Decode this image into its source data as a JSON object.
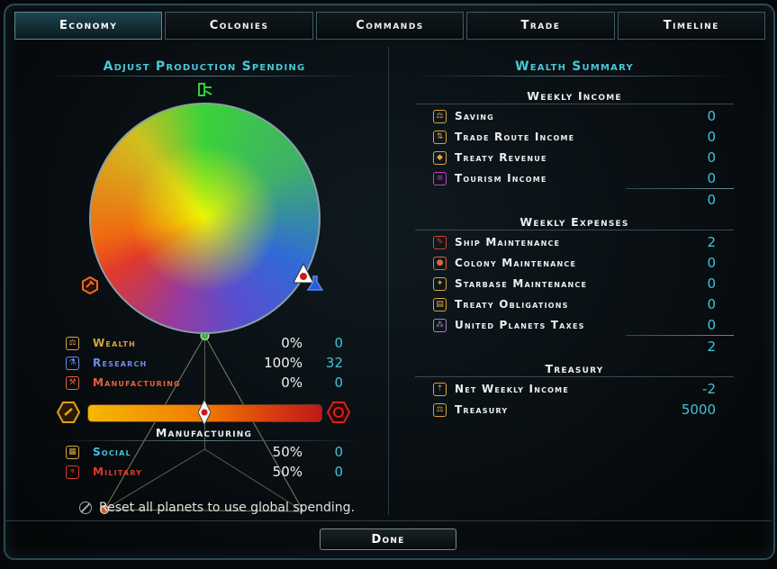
{
  "tabs": [
    {
      "label": "Economy",
      "active": true
    },
    {
      "label": "Colonies",
      "active": false
    },
    {
      "label": "Commands",
      "active": false
    },
    {
      "label": "Trade",
      "active": false
    },
    {
      "label": "Timeline",
      "active": false
    }
  ],
  "left": {
    "title": "Adjust Production Spending",
    "wheel": {
      "wealth": 0,
      "research": 100,
      "manufacturing": 0,
      "selected_vertex": "research"
    },
    "rows": [
      {
        "label": "Wealth",
        "pct": "0%",
        "value": "0",
        "color": "#d9a43a",
        "icon": "scales-icon"
      },
      {
        "label": "Research",
        "pct": "100%",
        "value": "32",
        "color": "#6f8de8",
        "icon": "flask-icon"
      },
      {
        "label": "Manufacturing",
        "pct": "0%",
        "value": "0",
        "color": "#e8603a",
        "icon": "hammer-icon"
      }
    ],
    "slider": {
      "title": "Manufacturing",
      "social_fraction": 0.5
    },
    "sub_rows": [
      {
        "label": "Social",
        "pct": "50%",
        "value": "0",
        "color": "#3fc6d6",
        "icon": "building-icon"
      },
      {
        "label": "Military",
        "pct": "50%",
        "value": "0",
        "color": "#e23a2a",
        "icon": "crosshair-icon"
      }
    ],
    "reset_label": "Reset all planets to use global spending."
  },
  "right": {
    "title": "Wealth Summary",
    "income": {
      "heading": "Weekly Income",
      "items": [
        {
          "label": "Saving",
          "value": "0",
          "icon": "scales-icon",
          "color": "#d9a43a"
        },
        {
          "label": "Trade Route Income",
          "value": "0",
          "icon": "trade-icon",
          "color": "#d9a43a"
        },
        {
          "label": "Treaty Revenue",
          "value": "0",
          "icon": "handshake-icon",
          "color": "#d9a43a"
        },
        {
          "label": "Tourism Income",
          "value": "0",
          "icon": "tourism-icon",
          "color": "#c040c0"
        }
      ],
      "total": "0"
    },
    "expenses": {
      "heading": "Weekly Expenses",
      "items": [
        {
          "label": "Ship Maintenance",
          "value": "2",
          "icon": "wrench-icon",
          "color": "#e23a2a"
        },
        {
          "label": "Colony Maintenance",
          "value": "0",
          "icon": "colony-icon",
          "color": "#e8603a"
        },
        {
          "label": "Starbase Maintenance",
          "value": "0",
          "icon": "starbase-icon",
          "color": "#d9a43a"
        },
        {
          "label": "Treaty Obligations",
          "value": "0",
          "icon": "document-icon",
          "color": "#d9a43a"
        },
        {
          "label": "United Planets Taxes",
          "value": "0",
          "icon": "planets-icon",
          "color": "#b080c0"
        }
      ],
      "total": "2"
    },
    "treasury": {
      "heading": "Treasury",
      "items": [
        {
          "label": "Net Weekly Income",
          "value": "-2",
          "icon": "net-income-icon",
          "color": "#d9a43a"
        },
        {
          "label": "Treasury",
          "value": "5000",
          "icon": "scales-icon",
          "color": "#d9a43a"
        }
      ]
    }
  },
  "done_label": "Done"
}
